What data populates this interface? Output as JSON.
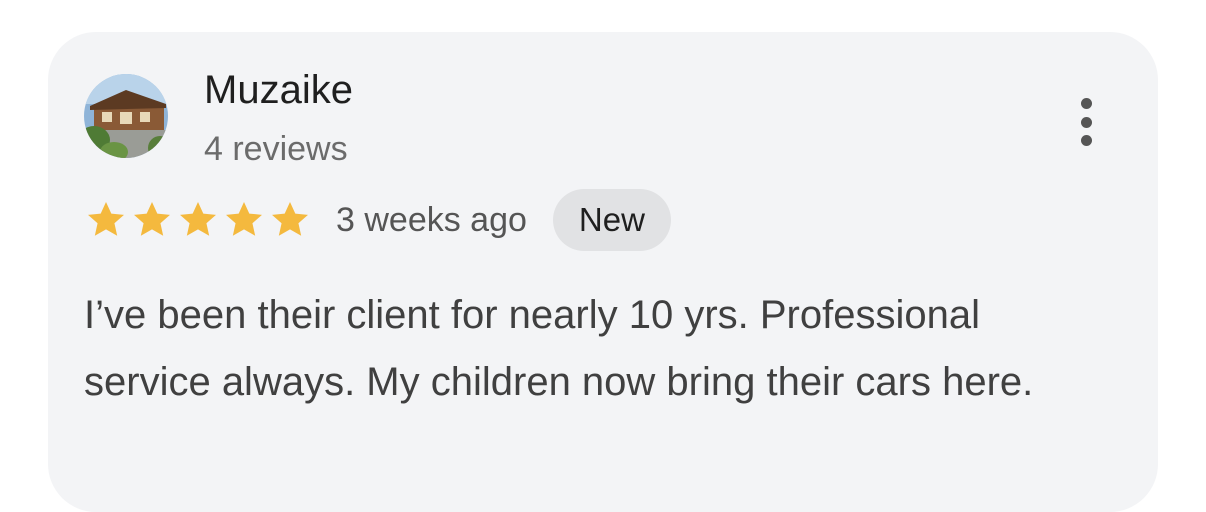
{
  "review": {
    "author": "Muzaike",
    "author_meta": "4 reviews",
    "avatar_icon": "house-photo-avatar",
    "more_icon": "more-vertical-icon",
    "rating": 5,
    "rating_max": 5,
    "star_color": "#f4b93e",
    "time_ago": "3 weeks ago",
    "badge": "New",
    "text": "I’ve been their client for nearly 10 yrs. Professional service always. My children now bring their cars here."
  }
}
